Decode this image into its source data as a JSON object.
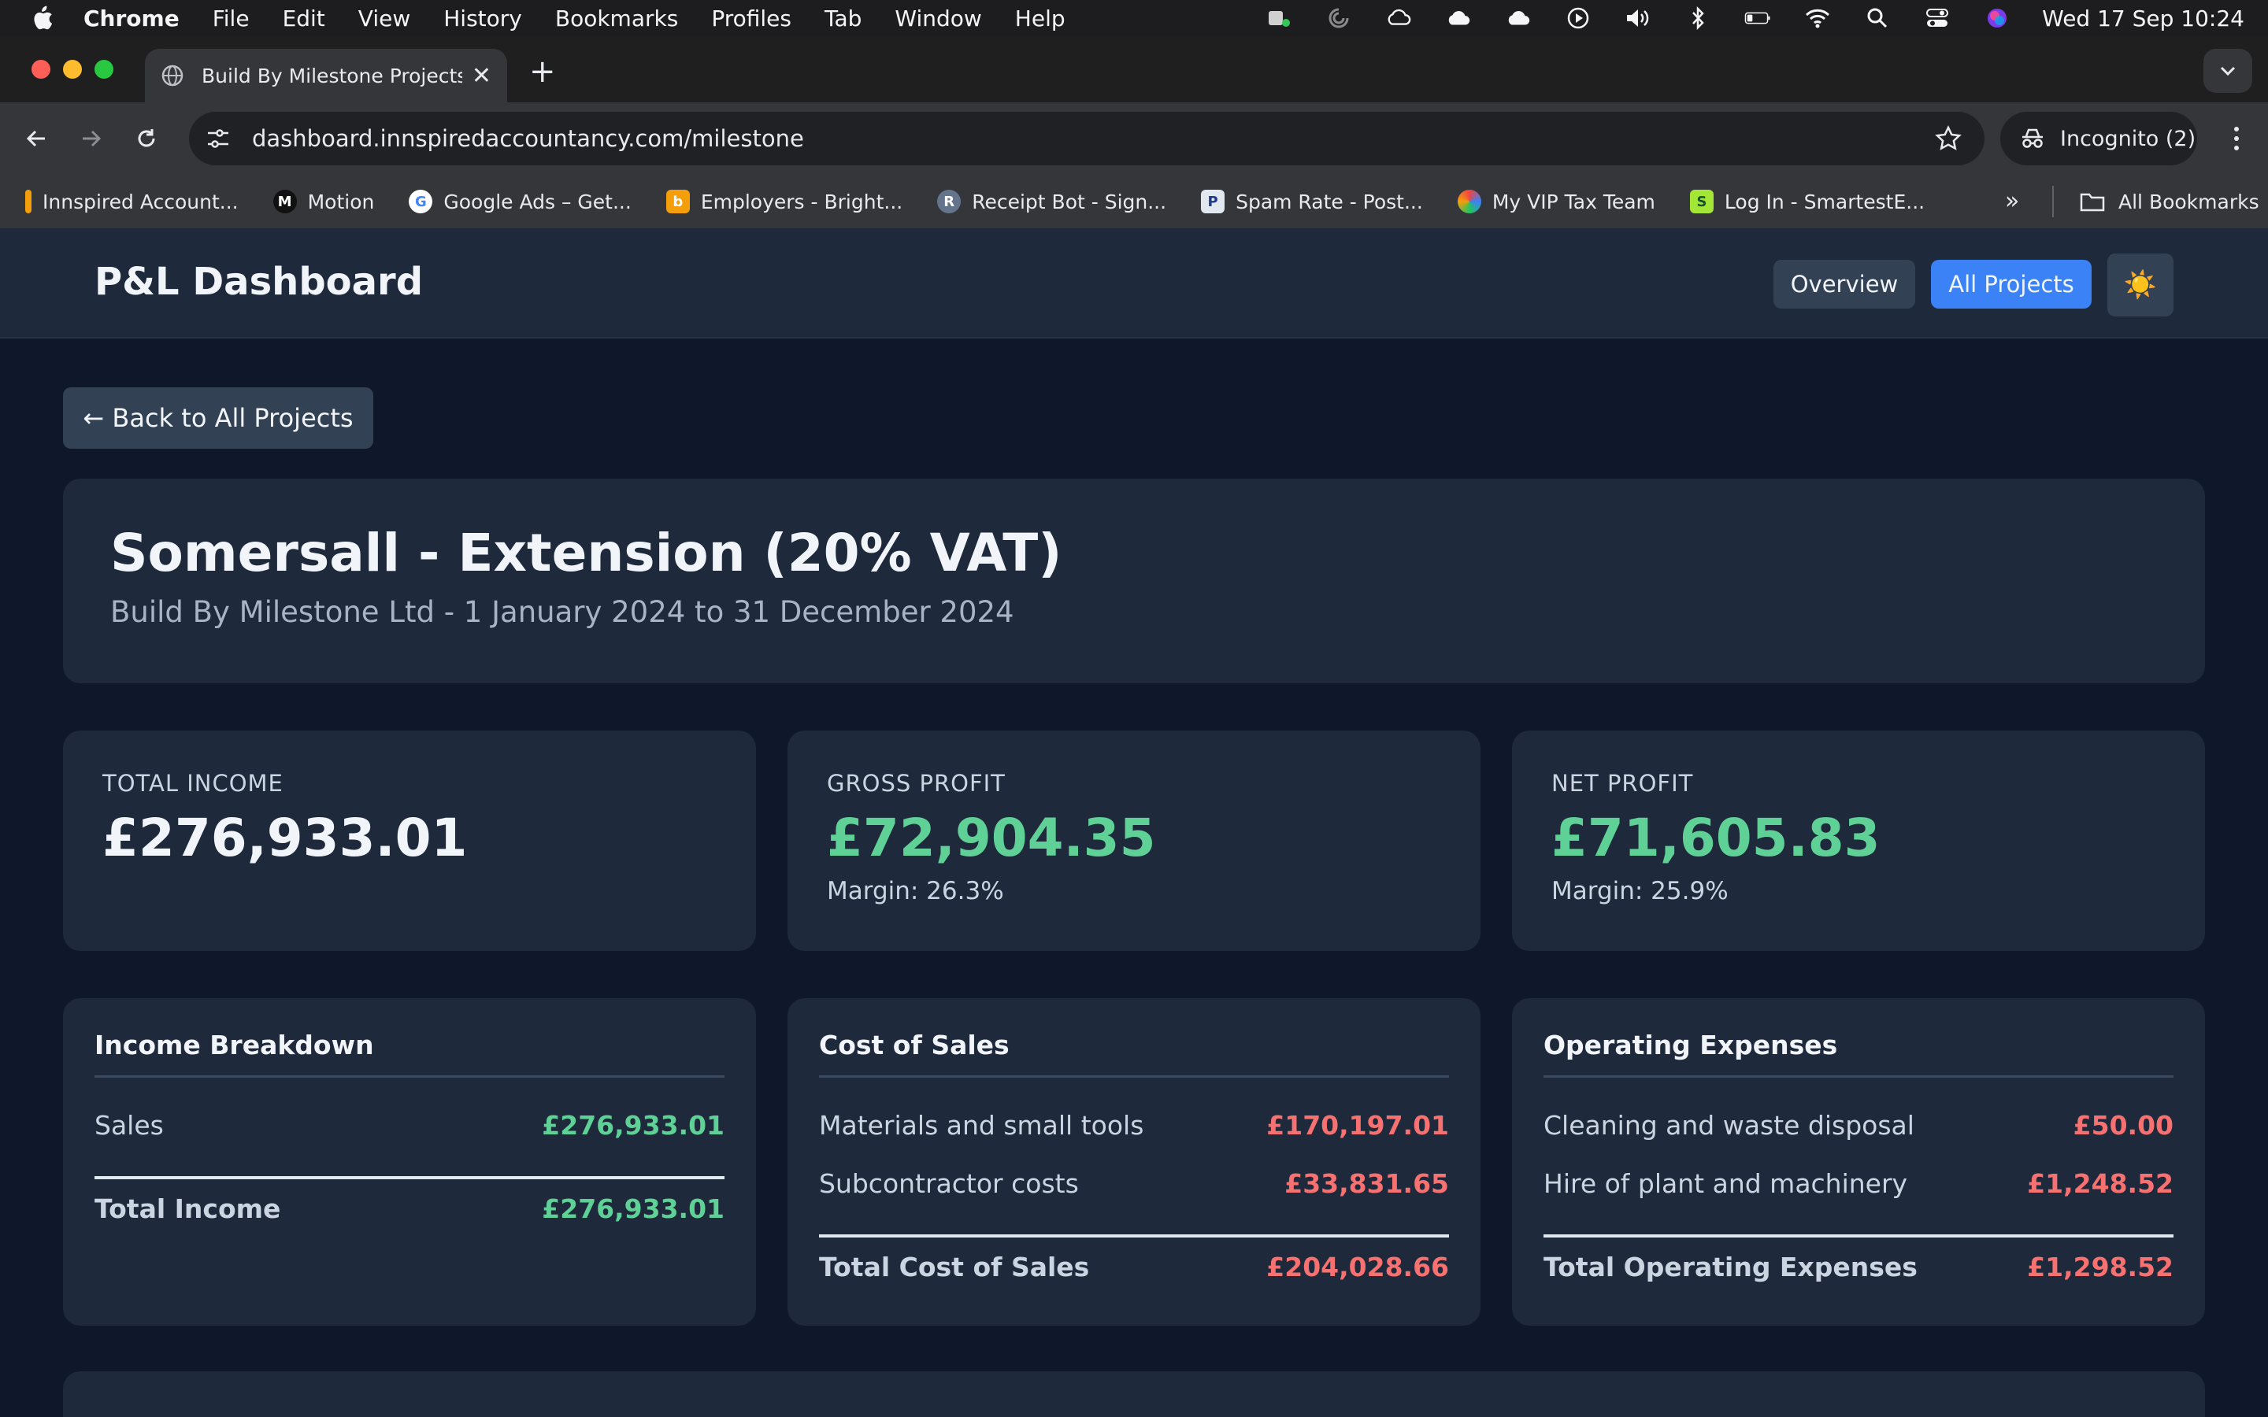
{
  "menubar": {
    "app": "Chrome",
    "items": [
      "File",
      "Edit",
      "View",
      "History",
      "Bookmarks",
      "Profiles",
      "Tab",
      "Window",
      "Help"
    ],
    "clock": "Wed 17 Sep  10:24"
  },
  "browser": {
    "tab_title": "Build By Milestone Projects D",
    "url": "dashboard.innspiredaccountancy.com/milestone",
    "incognito_label": "Incognito (2)",
    "bookmarks": [
      {
        "label": "Innspired Account...",
        "icon": "innspired-favicon",
        "color": "#f59e0b",
        "glyph": "i"
      },
      {
        "label": "Motion",
        "icon": "motion-favicon",
        "color": "#111111",
        "glyph": "M"
      },
      {
        "label": "Google Ads – Get...",
        "icon": "google-favicon",
        "color": "#ffffff",
        "glyph": "G"
      },
      {
        "label": "Employers - Bright...",
        "icon": "brightpay-favicon",
        "color": "#f59e0b",
        "glyph": "b"
      },
      {
        "label": "Receipt Bot - Sign...",
        "icon": "receiptbot-favicon",
        "color": "#64748b",
        "glyph": "R"
      },
      {
        "label": "Spam Rate - Post...",
        "icon": "postmaster-favicon",
        "color": "#e2e8f0",
        "glyph": "P"
      },
      {
        "label": "My VIP Tax Team",
        "icon": "viptax-favicon",
        "color": "#ef4444",
        "glyph": "V"
      },
      {
        "label": "Log In - SmartestE...",
        "icon": "smartest-favicon",
        "color": "#a3e635",
        "glyph": "S"
      }
    ],
    "all_bookmarks": "All Bookmarks"
  },
  "header": {
    "brand": "P&L Dashboard",
    "nav": {
      "overview": "Overview",
      "all_projects": "All Projects",
      "theme_toggle": "☀️"
    }
  },
  "back_button": "← Back to All Projects",
  "project": {
    "title": "Somersall - Extension (20% VAT)",
    "subtitle": "Build By Milestone Ltd - 1 January 2024 to 31 December 2024"
  },
  "kpis": {
    "total_income": {
      "label": "TOTAL INCOME",
      "value": "£276,933.01"
    },
    "gross_profit": {
      "label": "GROSS PROFIT",
      "value": "£72,904.35",
      "margin": "Margin: 26.3%"
    },
    "net_profit": {
      "label": "NET PROFIT",
      "value": "£71,605.83",
      "margin": "Margin: 25.9%"
    }
  },
  "income": {
    "title": "Income Breakdown",
    "rows": [
      {
        "label": "Sales",
        "value": "£276,933.01"
      }
    ],
    "total": {
      "label": "Total Income",
      "value": "£276,933.01"
    }
  },
  "cost_of_sales": {
    "title": "Cost of Sales",
    "rows": [
      {
        "label": "Materials and small tools",
        "value": "£170,197.01"
      },
      {
        "label": "Subcontractor costs",
        "value": "£33,831.65"
      }
    ],
    "total": {
      "label": "Total Cost of Sales",
      "value": "£204,028.66"
    }
  },
  "operating_expenses": {
    "title": "Operating Expenses",
    "rows": [
      {
        "label": "Cleaning and waste disposal",
        "value": "£50.00"
      },
      {
        "label": "Hire of plant and machinery",
        "value": "£1,248.52"
      }
    ],
    "total": {
      "label": "Total Operating Expenses",
      "value": "£1,298.52"
    }
  },
  "colors": {
    "accent": "#3b82f6",
    "positive": "#5fd196",
    "negative": "#f87171",
    "card": "#1e293b",
    "background": "#0f172a"
  }
}
